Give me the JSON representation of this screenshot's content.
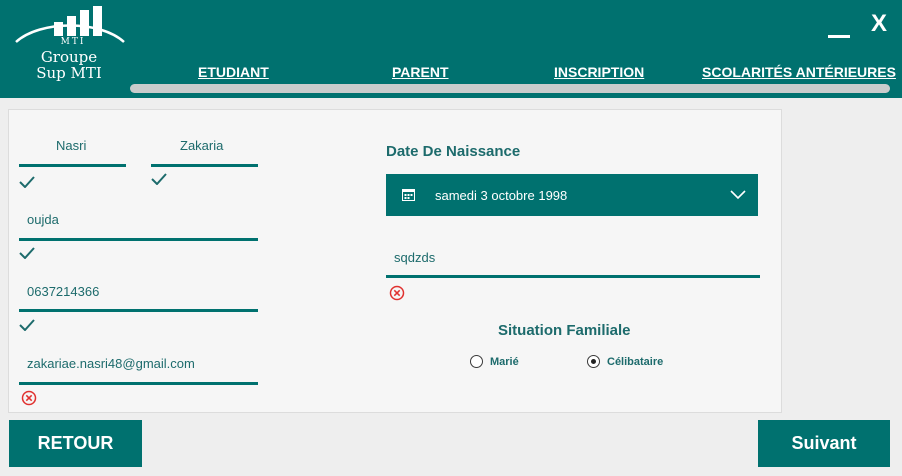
{
  "header": {
    "logo": {
      "line1": "Groupe",
      "line2": "Sup MTI",
      "badge": "MTI"
    },
    "window": {
      "minimize": "__",
      "close": "X"
    },
    "nav": [
      {
        "label": "ETUDIANT"
      },
      {
        "label": "PARENT"
      },
      {
        "label": "INSCRIPTION"
      },
      {
        "label": "SCOLARITÉS ANTÉRIEURES"
      }
    ]
  },
  "form": {
    "nom": "Nasri",
    "prenom": "Zakaria",
    "ville": "oujda",
    "telephone": "0637214366",
    "email": "zakariae.nasri48@gmail.com",
    "date_title": "Date De Naissance",
    "date_value": "samedi 3 octobre 1998",
    "other_field": "sqdzds",
    "situation_title": "Situation Familiale",
    "situation_options": [
      {
        "label": "Marié",
        "selected": false
      },
      {
        "label": "Célibataire",
        "selected": true
      }
    ]
  },
  "buttons": {
    "back": "RETOUR",
    "next": "Suivant"
  },
  "colors": {
    "primary": "#00716f",
    "valid": "#1d6b6c",
    "error": "#e0312f",
    "track": "#c9cccc"
  },
  "icons": {
    "valid": "check-icon",
    "invalid": "error-circle-icon",
    "calendar": "calendar-icon",
    "dropdown": "chevron-down-icon"
  }
}
